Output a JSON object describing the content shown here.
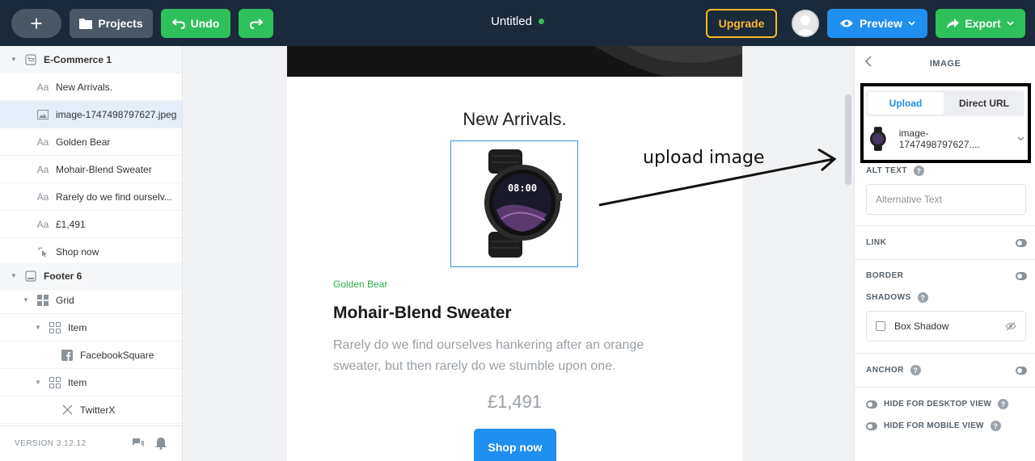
{
  "topbar": {
    "add_label": "+",
    "projects_label": "Projects",
    "undo_label": "Undo",
    "document_title": "Untitled",
    "upgrade_label": "Upgrade",
    "preview_label": "Preview",
    "export_label": "Export"
  },
  "layers": [
    {
      "label": "E-Commerce 1",
      "type": "section",
      "icon": "cart-icon"
    },
    {
      "label": "New Arrivals.",
      "type": "text",
      "icon": "text-icon"
    },
    {
      "label": "image-1747498797627.jpeg",
      "type": "image",
      "icon": "image-icon",
      "selected": true
    },
    {
      "label": "Golden Bear",
      "type": "text",
      "icon": "text-icon"
    },
    {
      "label": "Mohair-Blend Sweater",
      "type": "text",
      "icon": "text-icon"
    },
    {
      "label": "Rarely do we find ourselv...",
      "type": "text",
      "icon": "text-icon"
    },
    {
      "label": "£1,491",
      "type": "text",
      "icon": "text-icon"
    },
    {
      "label": "Shop now",
      "type": "button",
      "icon": "pointer-icon"
    },
    {
      "label": "Footer 6",
      "type": "section",
      "icon": "footer-icon"
    },
    {
      "label": "Grid",
      "type": "grid",
      "icon": "grid-icon"
    },
    {
      "label": "Item",
      "type": "item",
      "icon": "item-icon"
    },
    {
      "label": "FacebookSquare",
      "type": "social",
      "icon": "facebook-icon"
    },
    {
      "label": "Item",
      "type": "item",
      "icon": "item-icon"
    },
    {
      "label": "TwitterX",
      "type": "social",
      "icon": "x-icon"
    }
  ],
  "left_footer": {
    "version": "VERSION 3.12.12"
  },
  "canvas": {
    "heading": "New Arrivals.",
    "brand": "Golden Bear",
    "product_name": "Mohair-Blend Sweater",
    "description": "Rarely do we find ourselves hankering after an orange sweater, but then rarely do we stumble upon one.",
    "price": "£1,491",
    "cta": "Shop now",
    "annotation": "upload image",
    "watch_time": "08:00"
  },
  "inspector": {
    "title": "IMAGE",
    "tab_upload": "Upload",
    "tab_url": "Direct URL",
    "file_name": "image-1747498797627....",
    "alt_label": "ALT TEXT",
    "alt_placeholder": "Alternative Text",
    "link_label": "LINK",
    "border_label": "BORDER",
    "shadows_label": "SHADOWS",
    "shadow_option": "Box Shadow",
    "anchor_label": "ANCHOR",
    "hide_desktop": "HIDE FOR DESKTOP VIEW",
    "hide_mobile": "HIDE FOR MOBILE VIEW"
  },
  "colors": {
    "topbar_bg": "#1b2a3a",
    "green": "#2ec05a",
    "blue": "#1f8ff0",
    "upgrade": "#f5b82e"
  }
}
